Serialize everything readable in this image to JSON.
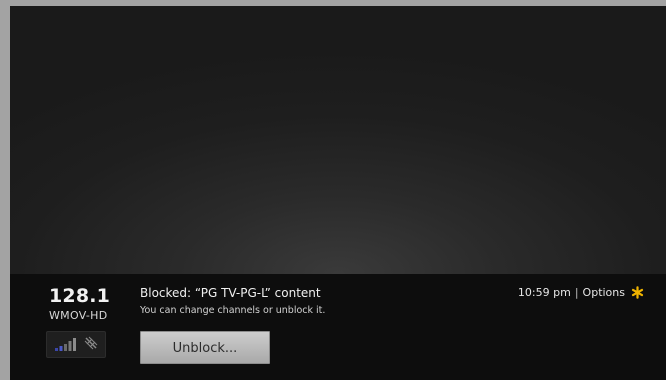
{
  "channel": {
    "number": "128.1",
    "name": "WMOV-HD",
    "icons": {
      "signal": "signal-strength-icon",
      "antenna": "antenna-icon"
    }
  },
  "message": {
    "title": "Blocked: “PG TV-PG-L” content",
    "subtitle": "You can change channels or unblock it."
  },
  "actions": {
    "unblock_label": "Unblock..."
  },
  "status": {
    "time": "10:59 pm",
    "separator": "|",
    "options_label": "Options",
    "options_icon": "asterisk-icon",
    "accent_color": "#f0b400"
  }
}
